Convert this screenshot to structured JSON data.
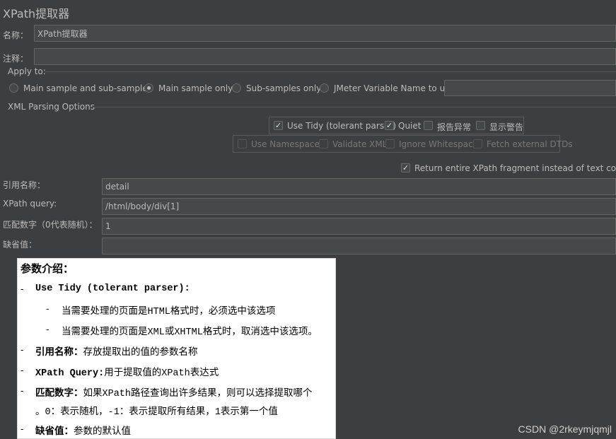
{
  "title": "XPath提取器",
  "name": {
    "label": "名称：",
    "value": "XPath提取器"
  },
  "comment": {
    "label": "注释：",
    "value": ""
  },
  "apply_to": {
    "legend": "Apply to:",
    "options": [
      "Main sample and sub-samples",
      "Main sample only",
      "Sub-samples only",
      "JMeter Variable Name to use"
    ],
    "selected": "Main sample only",
    "variable_value": ""
  },
  "xml_options": {
    "legend": "XML Parsing Options",
    "use_tidy": "Use Tidy (tolerant parser)",
    "quiet": "Quiet",
    "report_errors": "报告异常",
    "show_warnings": "显示警告",
    "use_namespaces": "Use Namespaces",
    "validate_xml": "Validate XML",
    "ignore_whitespace": "Ignore Whitespace",
    "fetch_dtds": "Fetch external DTDs",
    "return_fragment": "Return entire XPath fragment instead of text content?"
  },
  "fields": {
    "ref_name": {
      "label": "引用名称：",
      "value": "detail"
    },
    "xpath_query": {
      "label": "XPath query:",
      "value": "/html/body/div[1]"
    },
    "match_no": {
      "label": "匹配数字（0代表随机）：",
      "value": "1"
    },
    "default_value": {
      "label": "缺省值：",
      "value": ""
    }
  },
  "info": {
    "heading": "参数介绍：",
    "tidy_term": "Use Tidy (tolerant parser):",
    "tidy_1a": "当需要处理的页面是",
    "tidy_1b": "HTML",
    "tidy_1c": "格式时，必须选中该选项",
    "tidy_2a": "当需要处理的页面是",
    "tidy_2b": "XML",
    "tidy_2c": "或",
    "tidy_2d": "XHTML",
    "tidy_2e": "格式时，取消选中该选项。",
    "ref_term": "引用名称：",
    "ref_desc": "存放提取出的值的参数名称",
    "query_term": "XPath Query:",
    "query_desc_a": "用于提取值的",
    "query_desc_b": "XPath",
    "query_desc_c": "表达式",
    "match_term": "匹配数字：",
    "match_desc_a": "如果",
    "match_desc_b": "XPath",
    "match_desc_c": "路径查询出许多结果，则可以选择提取哪个",
    "match_line2_a": "。",
    "match_line2_b": "0",
    "match_line2_c": "：表示随机，",
    "match_line2_d": "-1",
    "match_line2_e": "：表示提取所有结果，",
    "match_line2_f": "1",
    "match_line2_g": "表示第一个值",
    "default_term": "缺省值：",
    "default_desc": "参数的默认值",
    "dash": "-"
  },
  "watermark": "CSDN @2rkeymjqmjl"
}
